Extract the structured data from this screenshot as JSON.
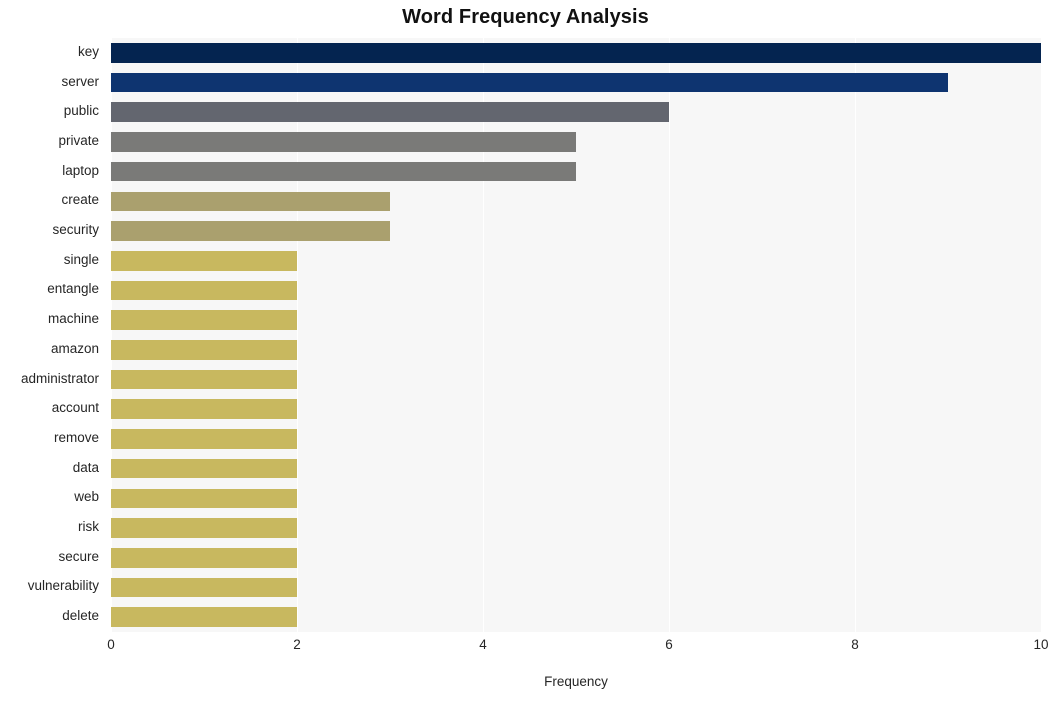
{
  "chart_data": {
    "type": "bar",
    "orientation": "horizontal",
    "title": "Word Frequency Analysis",
    "xlabel": "Frequency",
    "ylabel": "",
    "xlim": [
      0,
      10
    ],
    "x_ticks": [
      0,
      2,
      4,
      6,
      8,
      10
    ],
    "x_tick_labels": [
      "0",
      "2",
      "4",
      "6",
      "8",
      "10"
    ],
    "grid": true,
    "grid_axis": "x",
    "legend": false,
    "plot_background": "#f7f7f7",
    "gridline_color": "#ffffff",
    "figure_background": "#ffffff",
    "categories": [
      "key",
      "server",
      "public",
      "private",
      "laptop",
      "create",
      "security",
      "single",
      "entangle",
      "machine",
      "amazon",
      "administrator",
      "account",
      "remove",
      "data",
      "web",
      "risk",
      "secure",
      "vulnerability",
      "delete"
    ],
    "values": [
      10,
      9,
      6,
      5,
      5,
      3,
      3,
      2,
      2,
      2,
      2,
      2,
      2,
      2,
      2,
      2,
      2,
      2,
      2,
      2
    ],
    "bar_colors": [
      "#042450",
      "#0e3470",
      "#63666f",
      "#7a7a78",
      "#7a7a78",
      "#aaa06e",
      "#aaa06e",
      "#c8b85f",
      "#c8b85f",
      "#c8b85f",
      "#c8b85f",
      "#c8b85f",
      "#c8b85f",
      "#c8b85f",
      "#c8b85f",
      "#c8b85f",
      "#c8b85f",
      "#c8b85f",
      "#c8b85f",
      "#c8b85f"
    ]
  }
}
